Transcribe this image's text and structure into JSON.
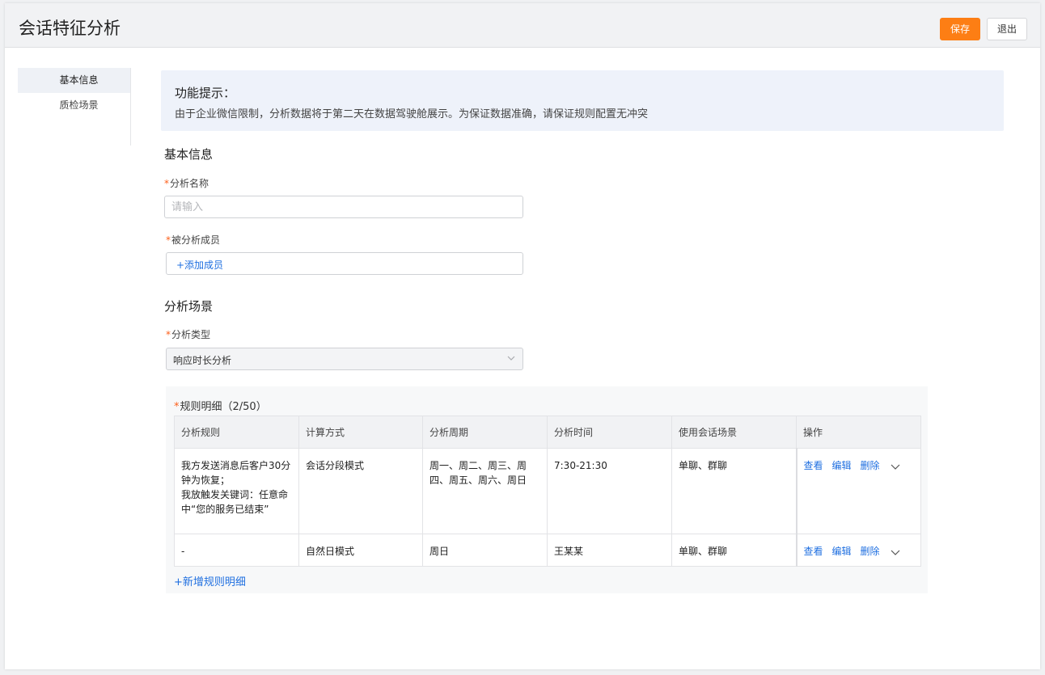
{
  "header": {
    "title": "会话特征分析",
    "save_label": "保存",
    "exit_label": "退出"
  },
  "sidebar": {
    "items": [
      {
        "label": "基本信息",
        "active": true
      },
      {
        "label": "质检场景",
        "active": false
      }
    ]
  },
  "tip": {
    "title": "功能提示：",
    "text": "由于企业微信限制，分析数据将于第二天在数据驾驶舱展示。为保证数据准确，请保证规则配置无冲突"
  },
  "basic_info": {
    "section_title": "基本信息",
    "name_label": "分析名称",
    "name_placeholder": "请输入",
    "name_value": "",
    "members_label": "被分析成员",
    "add_member_label": "+添加成员"
  },
  "scene": {
    "section_title": "分析场景",
    "type_label": "分析类型",
    "type_value": "响应时长分析",
    "rules_label": "规则明细（2/50）",
    "columns": [
      "分析规则",
      "计算方式",
      "分析周期",
      "分析时间",
      "使用会话场景",
      "操作"
    ],
    "rows": [
      {
        "rule": "我方发送消息后客户30分\n钟为恢复；\n我放触发关键词：任意命\n中“您的服务已结束”",
        "method": "会话分段模式",
        "period": "周一、周二、周三、周\n四、周五、周六、周日",
        "time": "7:30-21:30",
        "scene": "单聊、群聊"
      },
      {
        "rule": "-",
        "method": "自然日模式",
        "period": "周日",
        "time": "王某某",
        "scene": "单聊、群聊"
      }
    ],
    "op_view": "查看",
    "op_edit": "编辑",
    "op_delete": "删除",
    "add_rule_label": "+新增规则明细"
  },
  "colors": {
    "accent": "#fd7e14",
    "link": "#1f6fe0",
    "required": "#fd5f1a"
  },
  "icons": {
    "select_arrow": "chevron-down-icon",
    "row_more": "chevron-down-icon"
  }
}
